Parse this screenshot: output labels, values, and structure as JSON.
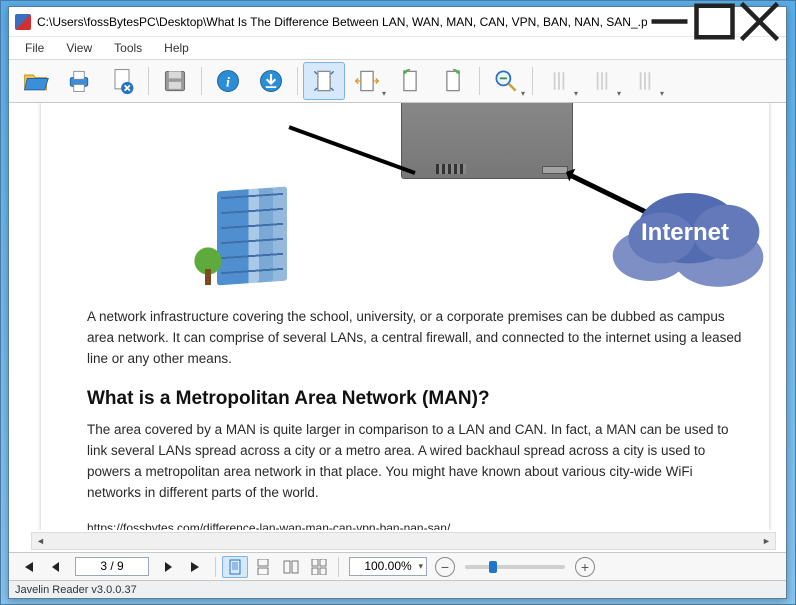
{
  "window": {
    "title": "C:\\Users\\fossBytesPC\\Desktop\\What Is The Difference Between LAN, WAN, MAN, CAN, VPN, BAN, NAN, SAN_.pdf"
  },
  "menu": {
    "file": "File",
    "view": "View",
    "tools": "Tools",
    "help": "Help"
  },
  "toolbar": {
    "open": "open-icon",
    "print": "print-icon",
    "remove": "close-file-icon",
    "save": "save-icon",
    "info": "info-icon",
    "download": "download-icon",
    "fit_page": "full-page-icon",
    "fit_width": "fit-width-icon",
    "fit_height": "fit-height-icon",
    "actual": "actual-size-icon",
    "zoom": "zoom-icon"
  },
  "doc": {
    "diagram_internet_label": "Internet",
    "p1": "A network infrastructure covering the school, university, or a corporate premises can be dubbed as campus area network. It can comprise of several LANs, a central firewall, and connected to the internet using a leased line or any other means.",
    "h2": "What is a Metropolitan Area Network (MAN)?",
    "p2": "The area covered by a MAN is quite larger in comparison to a LAN and CAN. In fact, a MAN can be used to link several LANs spread across a city or a metro area. A wired backhaul spread across a city is used to powers a metropolitan area network in that place. You might have known about various city-wide WiFi networks in different parts of the world.",
    "url": "https://fossbytes.com/difference-lan-wan-man-can-vpn-ban-nan-san/"
  },
  "nav": {
    "page": "3 / 9",
    "zoom": "100.00%"
  },
  "status": {
    "text": "Javelin Reader v3.0.0.37"
  }
}
